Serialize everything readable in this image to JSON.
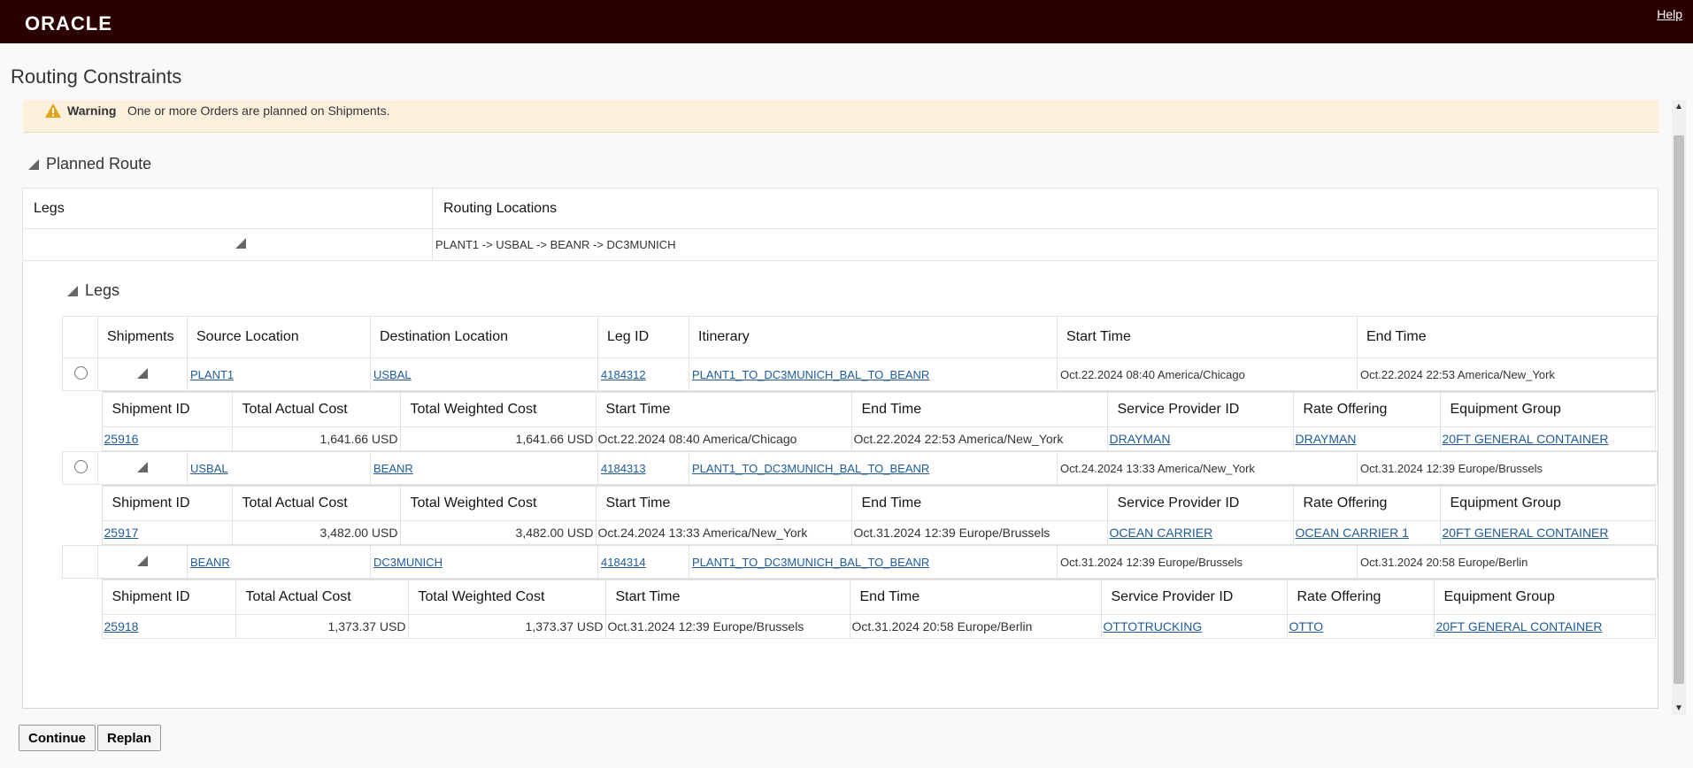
{
  "header": {
    "logo": "ORACLE",
    "help": "Help"
  },
  "page": {
    "title": "Routing Constraints"
  },
  "warning": {
    "label": "Warning",
    "text": "One or more Orders are planned on Shipments."
  },
  "planned_route": {
    "title": "Planned Route",
    "columns": [
      "Legs",
      "Routing Locations"
    ],
    "routing_locations": "PLANT1 -> USBAL -> BEANR -> DC3MUNICH"
  },
  "legs": {
    "title": "Legs",
    "columns": [
      "Shipments",
      "Source Location",
      "Destination Location",
      "Leg ID",
      "Itinerary",
      "Start Time",
      "End Time"
    ],
    "shipment_columns": [
      "Shipment ID",
      "Total Actual Cost",
      "Total Weighted Cost",
      "Start Time",
      "End Time",
      "Service Provider ID",
      "Rate Offering",
      "Equipment Group"
    ],
    "rows": [
      {
        "source": "PLANT1",
        "destination": "USBAL",
        "leg_id": "4184312",
        "itinerary": "PLANT1_TO_DC3MUNICH_BAL_TO_BEANR",
        "start": "Oct.22.2024 08:40 America/Chicago",
        "end": "Oct.22.2024 22:53 America/New_York",
        "shipment": {
          "id": "25916",
          "actual": "1,641.66 USD",
          "weighted": "1,641.66 USD",
          "start": "Oct.22.2024 08:40 America/Chicago",
          "end": "Oct.22.2024 22:53 America/New_York",
          "provider": "DRAYMAN",
          "rate": "DRAYMAN",
          "equipment": "20FT GENERAL CONTAINER"
        }
      },
      {
        "source": "USBAL",
        "destination": "BEANR",
        "leg_id": "4184313",
        "itinerary": "PLANT1_TO_DC3MUNICH_BAL_TO_BEANR",
        "start": "Oct.24.2024 13:33 America/New_York",
        "end": "Oct.31.2024 12:39 Europe/Brussels",
        "shipment": {
          "id": "25917",
          "actual": "3,482.00 USD",
          "weighted": "3,482.00 USD",
          "start": "Oct.24.2024 13:33 America/New_York",
          "end": "Oct.31.2024 12:39 Europe/Brussels",
          "provider": "OCEAN CARRIER",
          "rate": "OCEAN CARRIER 1",
          "equipment": "20FT GENERAL CONTAINER"
        }
      },
      {
        "source": "BEANR",
        "destination": "DC3MUNICH",
        "leg_id": "4184314",
        "itinerary": "PLANT1_TO_DC3MUNICH_BAL_TO_BEANR",
        "start": "Oct.31.2024 12:39 Europe/Brussels",
        "end": "Oct.31.2024 20:58 Europe/Berlin",
        "shipment": {
          "id": "25918",
          "actual": "1,373.37 USD",
          "weighted": "1,373.37 USD",
          "start": "Oct.31.2024 12:39 Europe/Brussels",
          "end": "Oct.31.2024 20:58 Europe/Berlin",
          "provider": "OTTOTRUCKING",
          "rate": "OTTO",
          "equipment": "20FT GENERAL CONTAINER"
        }
      }
    ]
  },
  "buttons": {
    "continue": "Continue",
    "replan": "Replan"
  }
}
